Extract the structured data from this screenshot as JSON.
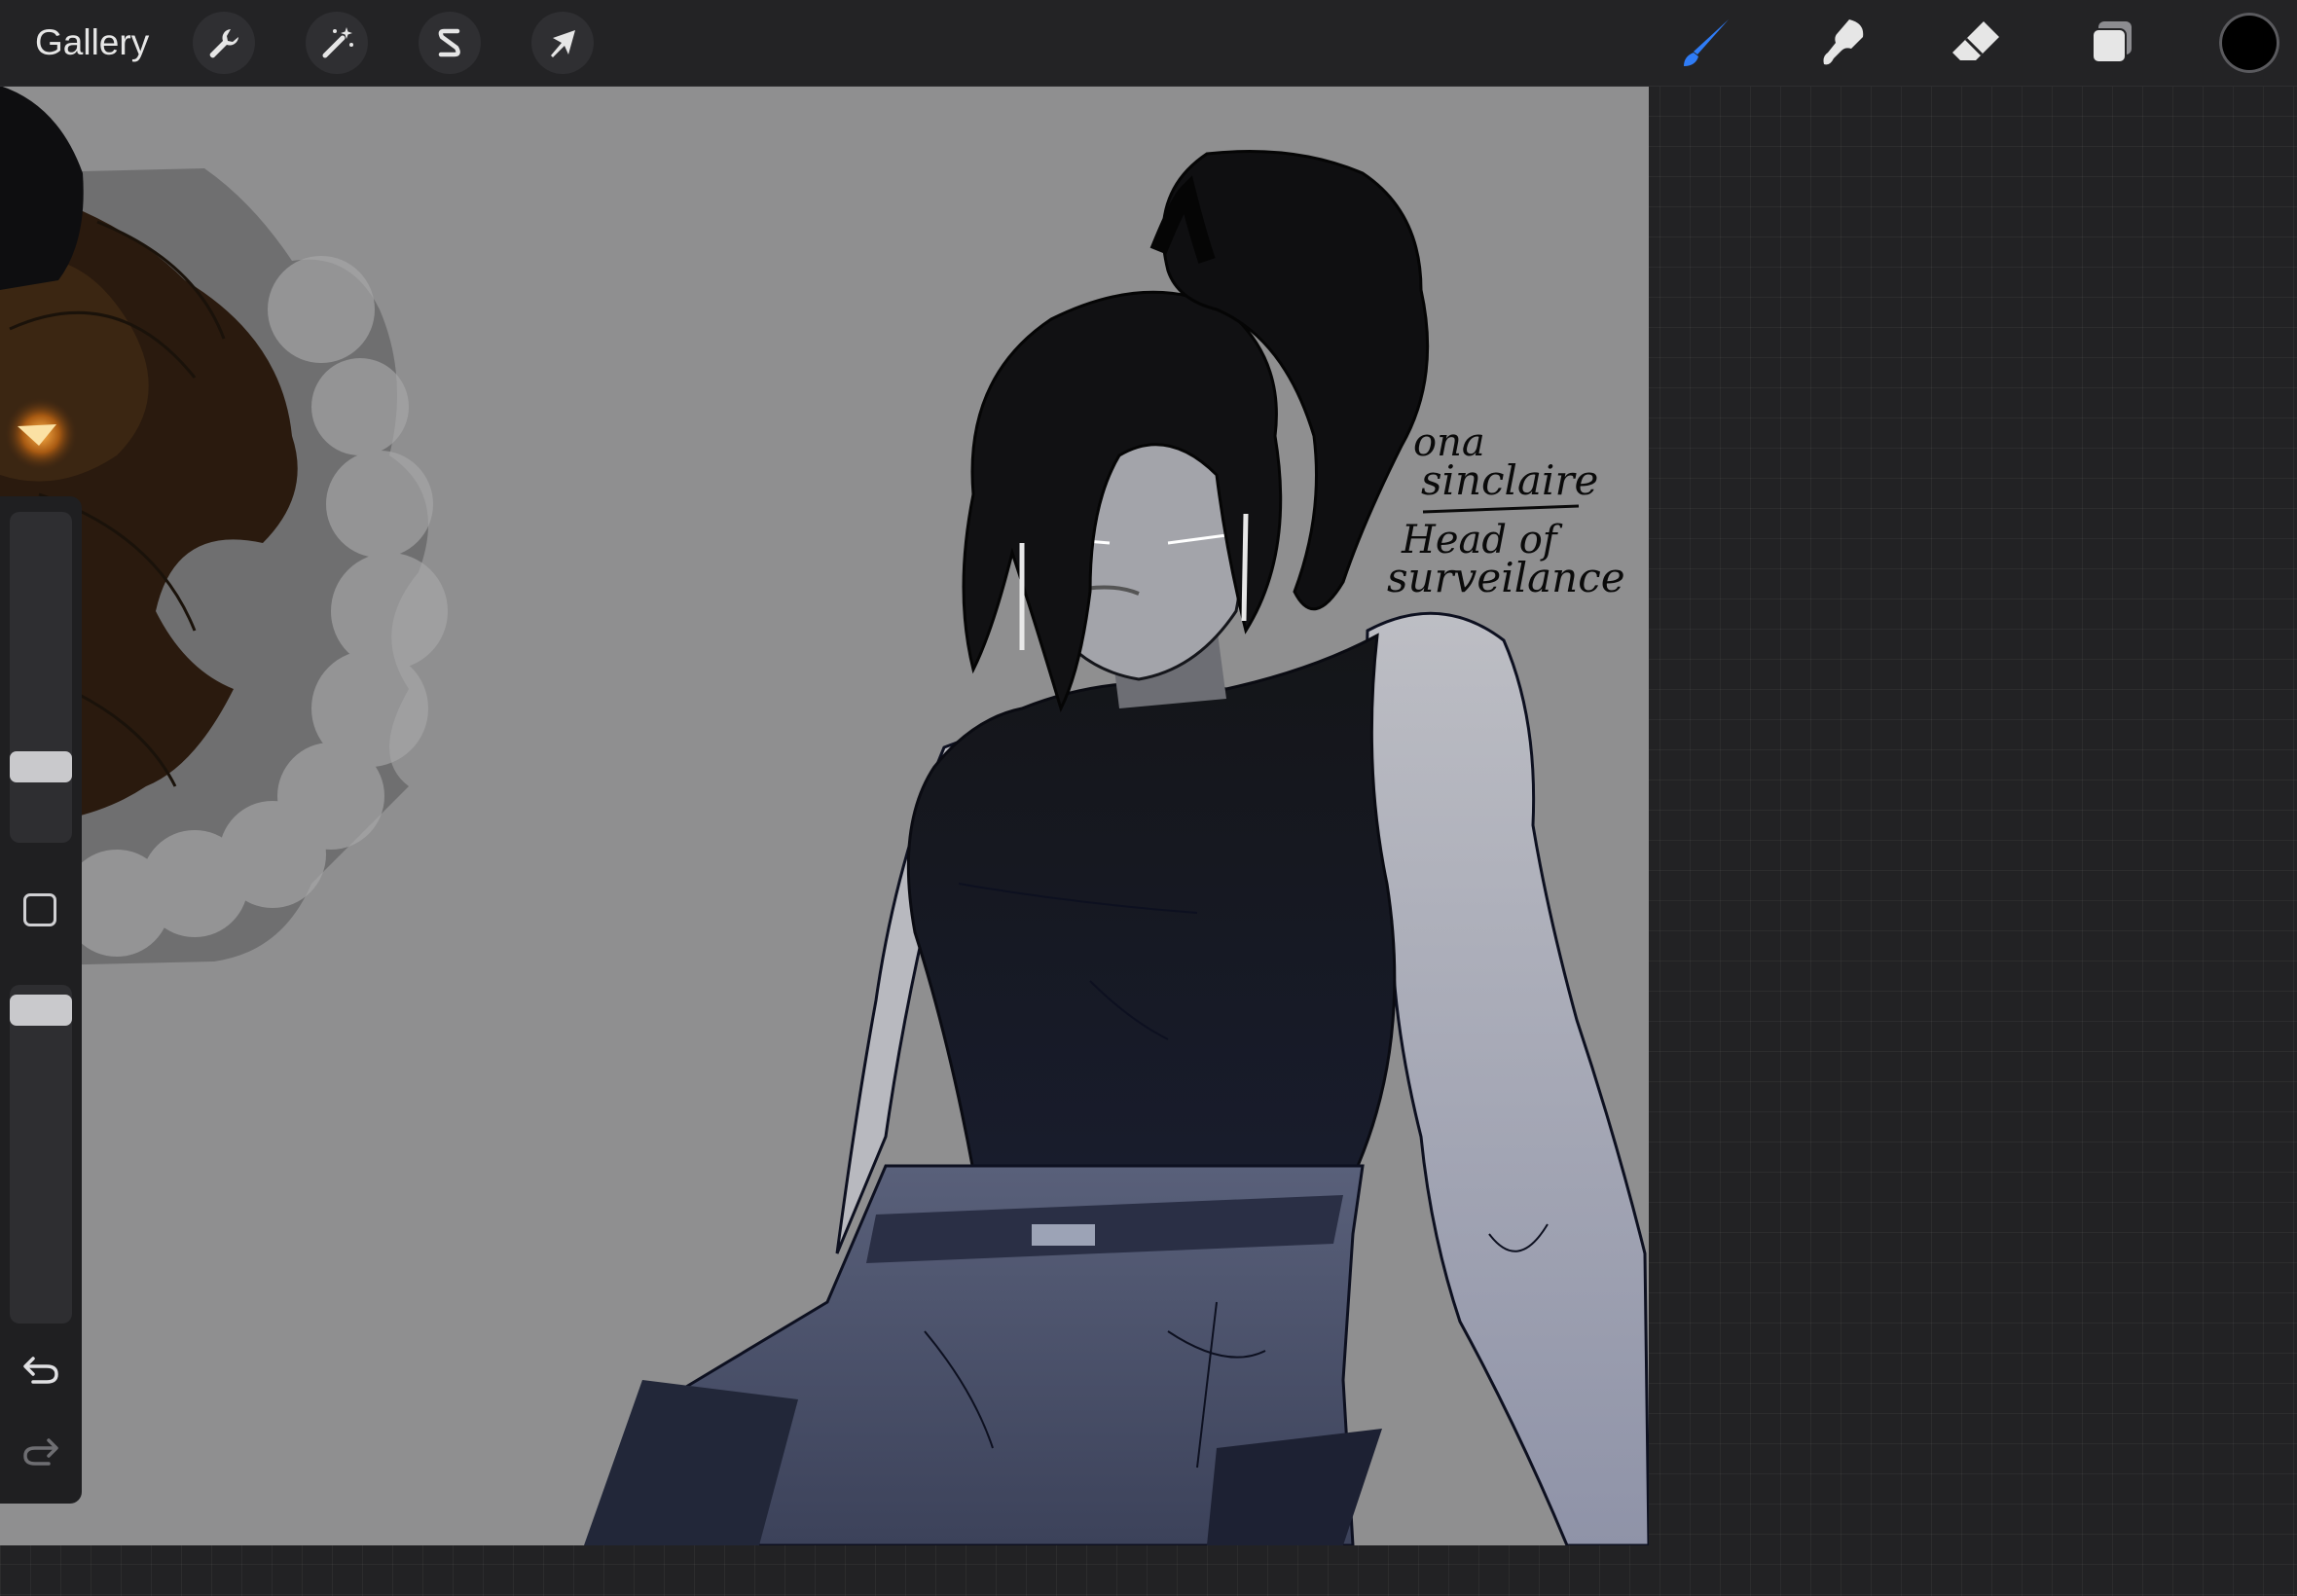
{
  "topbar": {
    "gallery_label": "Gallery",
    "left_tools": [
      "wrench-icon",
      "magic-wand-icon",
      "selection-s-icon",
      "arrow-cursor-icon"
    ],
    "right_tools": [
      "brush-icon",
      "smudge-icon",
      "eraser-icon",
      "layers-icon"
    ],
    "active_tool": "brush",
    "accent_color": "#2f7cf6",
    "current_color": "#000000"
  },
  "sidebar": {
    "brush_size_level": 0.25,
    "opacity_level": 1.0,
    "modifier_icon": "square-icon",
    "undo_icon": "undo-icon",
    "redo_icon": "redo-icon"
  },
  "canvas": {
    "background": "#8f8f90",
    "annotation": {
      "name_line1": "ona",
      "name_line2": "sinclaire",
      "role_line1": "Head of",
      "role_line2": "surveilance"
    }
  }
}
